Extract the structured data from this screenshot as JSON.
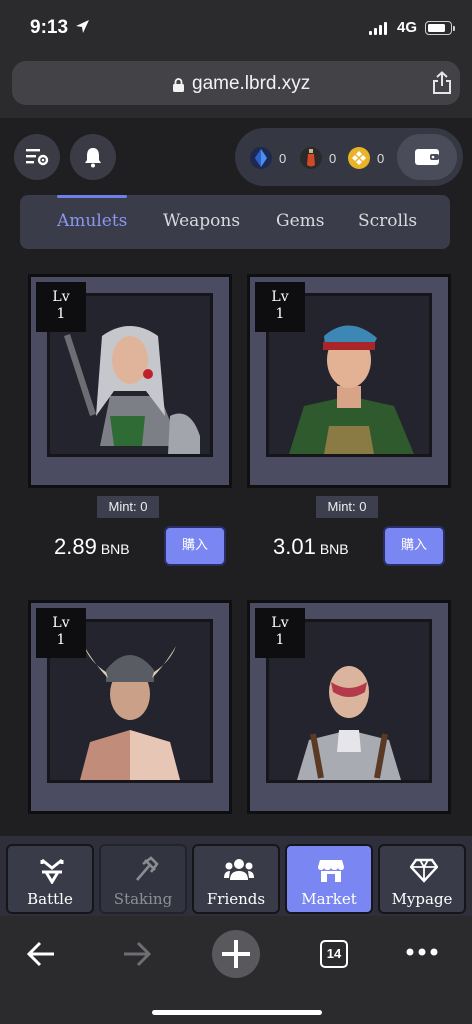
{
  "status_bar": {
    "time": "9:13",
    "network": "4G"
  },
  "browser": {
    "url": "game.lbrd.xyz",
    "tab_count": "14"
  },
  "header": {
    "balances": [
      {
        "icon": "crystal-icon",
        "value": "0"
      },
      {
        "icon": "potion-icon",
        "value": "0"
      },
      {
        "icon": "bnb-coin-icon",
        "value": "0"
      }
    ]
  },
  "tabs": [
    {
      "label": "Amulets",
      "active": true
    },
    {
      "label": "Weapons",
      "active": false
    },
    {
      "label": "Gems",
      "active": false
    },
    {
      "label": "Scrolls",
      "active": false
    }
  ],
  "cards": [
    {
      "level_label": "Lv",
      "level": "1",
      "mint": "Mint: 0",
      "price": "2.89",
      "unit": "BNB",
      "buy_label": "購入"
    },
    {
      "level_label": "Lv",
      "level": "1",
      "mint": "Mint: 0",
      "price": "3.01",
      "unit": "BNB",
      "buy_label": "購入"
    },
    {
      "level_label": "Lv",
      "level": "1"
    },
    {
      "level_label": "Lv",
      "level": "1"
    }
  ],
  "bottom_nav": [
    {
      "label": "Battle",
      "icon": "battle-icon"
    },
    {
      "label": "Staking",
      "icon": "staking-icon",
      "disabled": true
    },
    {
      "label": "Friends",
      "icon": "friends-icon"
    },
    {
      "label": "Market",
      "icon": "market-icon",
      "active": true
    },
    {
      "label": "Mypage",
      "icon": "diamond-icon"
    }
  ],
  "colors": {
    "accent": "#7a86f1",
    "background": "#1f1f21",
    "panel": "#3a3c4a"
  }
}
